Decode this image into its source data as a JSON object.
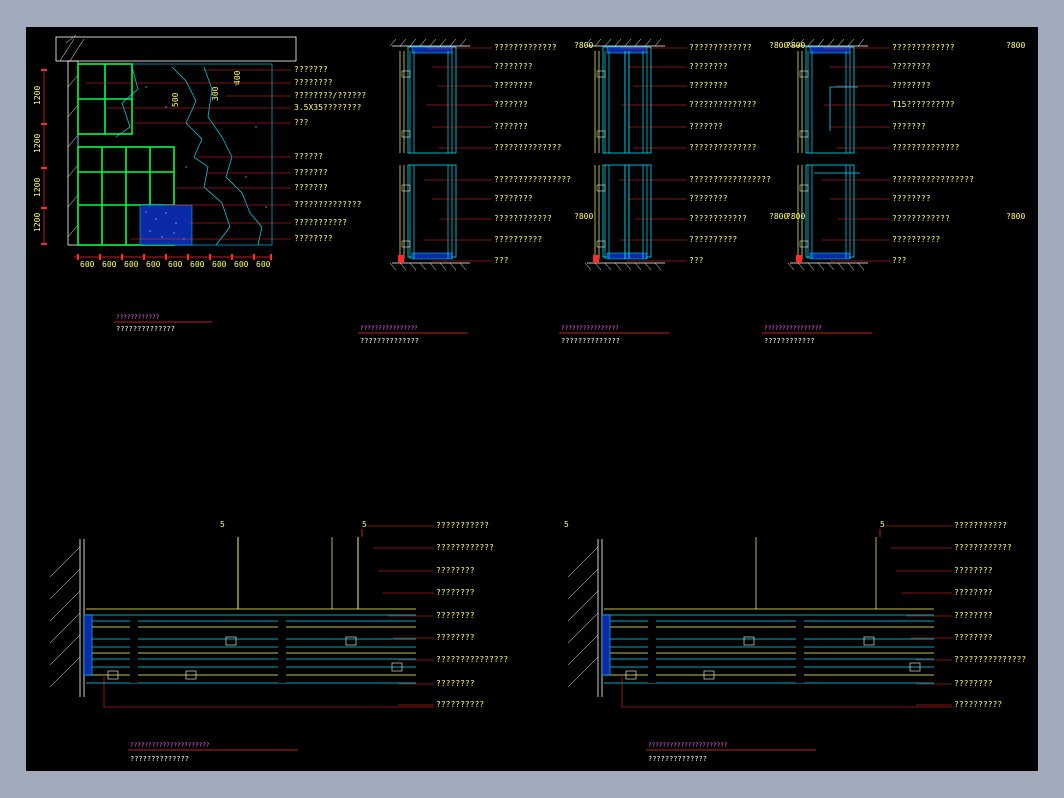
{
  "colors": {
    "background": "#a1abbb",
    "canvas": "#000000",
    "leader": "#ff2a2a",
    "text": "#ffff66",
    "frame": "#00ff3c",
    "profile": "#00e0ff"
  },
  "elevation": {
    "labels": [
      "???????",
      "????????",
      "????????/??????",
      "3.5X35????????",
      "???",
      "??????",
      "???????",
      "???????",
      "??????????????",
      "???????????",
      "????????"
    ],
    "v_dims": [
      "1200",
      "1200",
      "1200",
      "1200"
    ],
    "h_dims": [
      "600",
      "600",
      "600",
      "600",
      "600",
      "600",
      "600",
      "600",
      "600"
    ],
    "inline_dims": [
      "500",
      "300",
      "400"
    ],
    "title": "????????????",
    "subtitle": "??????????????"
  },
  "sections": [
    {
      "top_labels": [
        "?????????????",
        "????????",
        "????????",
        "???????",
        "???????",
        "??????????????"
      ],
      "bottom_labels": [
        "????????????????",
        "????????",
        "????????????",
        "??????????",
        "???"
      ],
      "dims": [
        "?800",
        "?800"
      ],
      "title": "????????????????",
      "subtitle": "??????????????"
    },
    {
      "top_labels": [
        "?????????????",
        "????????",
        "????????",
        "??????????????",
        "???????",
        "??????????????"
      ],
      "bottom_labels": [
        "?????????????????",
        "????????",
        "????????????",
        "??????????",
        "???"
      ],
      "dims": [
        "?800",
        "?800"
      ],
      "title": "????????????????",
      "subtitle": "??????????????"
    },
    {
      "top_labels": [
        "?????????????",
        "????????",
        "????????",
        "T15??????????",
        "???????",
        "??????????????"
      ],
      "bottom_labels": [
        "?????????????????",
        "????????",
        "????????????",
        "??????????",
        "???"
      ],
      "dims": [
        "?800",
        "?800",
        "?800",
        "?800"
      ],
      "title": "????????????????",
      "subtitle": "????????????"
    }
  ],
  "plans": [
    {
      "labels": [
        "???????????",
        "????????????",
        "????????",
        "????????",
        "????????",
        "????????",
        "???????????????",
        "????????",
        "??????????"
      ],
      "mark": "5",
      "title": "??????????????????????",
      "subtitle": "??????????????"
    },
    {
      "labels": [
        "???????????",
        "????????????",
        "????????",
        "????????",
        "????????",
        "????????",
        "???????????????",
        "????????",
        "??????????"
      ],
      "mark": "5",
      "title": "??????????????????????",
      "subtitle": "??????????????"
    }
  ]
}
